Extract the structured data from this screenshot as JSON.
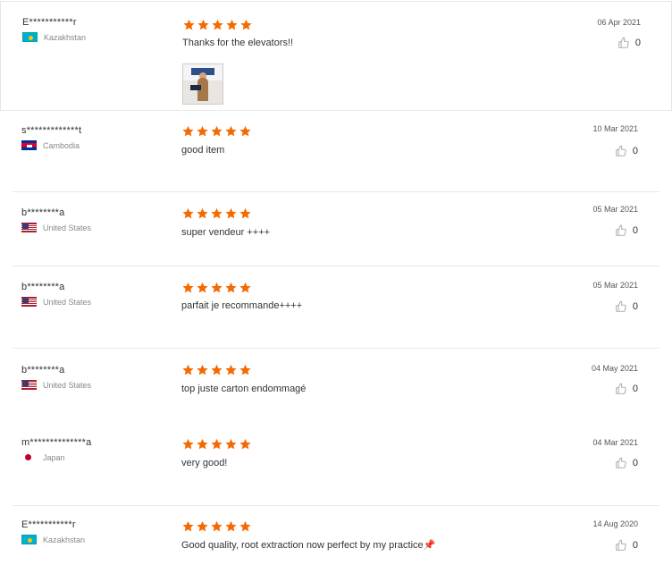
{
  "colors": {
    "star": "#f56a00",
    "separator": "#e8e8e8",
    "muted_text": "#888888"
  },
  "icons": {
    "rating": "star-icon",
    "like": "thumbs-up-icon",
    "text_emoji": "pushpin-icon"
  },
  "reviews": [
    {
      "name": "E***********r",
      "country": "Kazakhstan",
      "flag": "kz",
      "rating": 5,
      "text": "Thanks for the elevators!!",
      "date": "06 Apr 2021",
      "likes": "0",
      "has_photo": true
    },
    {
      "name": "s*************t",
      "country": "Cambodia",
      "flag": "kh",
      "rating": 5,
      "text": "good item",
      "date": "10 Mar 2021",
      "likes": "0"
    },
    {
      "name": "b********a",
      "country": "United States",
      "flag": "us",
      "rating": 5,
      "text": "super vendeur ++++",
      "date": "05 Mar 2021",
      "likes": "0"
    },
    {
      "name": "b********a",
      "country": "United States",
      "flag": "us",
      "rating": 5,
      "text": "parfait je recommande++++",
      "date": "05 Mar 2021",
      "likes": "0"
    },
    {
      "name": "b********a",
      "country": "United States",
      "flag": "us",
      "rating": 5,
      "text": "top juste carton endommagé",
      "date": "04 May 2021",
      "likes": "0"
    },
    {
      "name": "m**************a",
      "country": "Japan",
      "flag": "jp",
      "rating": 5,
      "text": "very good!",
      "date": "04 Mar 2021",
      "likes": "0"
    },
    {
      "name": "E***********r",
      "country": "Kazakhstan",
      "flag": "kz",
      "rating": 5,
      "text": "Good quality, root extraction now perfect by my practice",
      "date": "14 Aug 2020",
      "likes": "0",
      "emoji": "📌"
    }
  ]
}
